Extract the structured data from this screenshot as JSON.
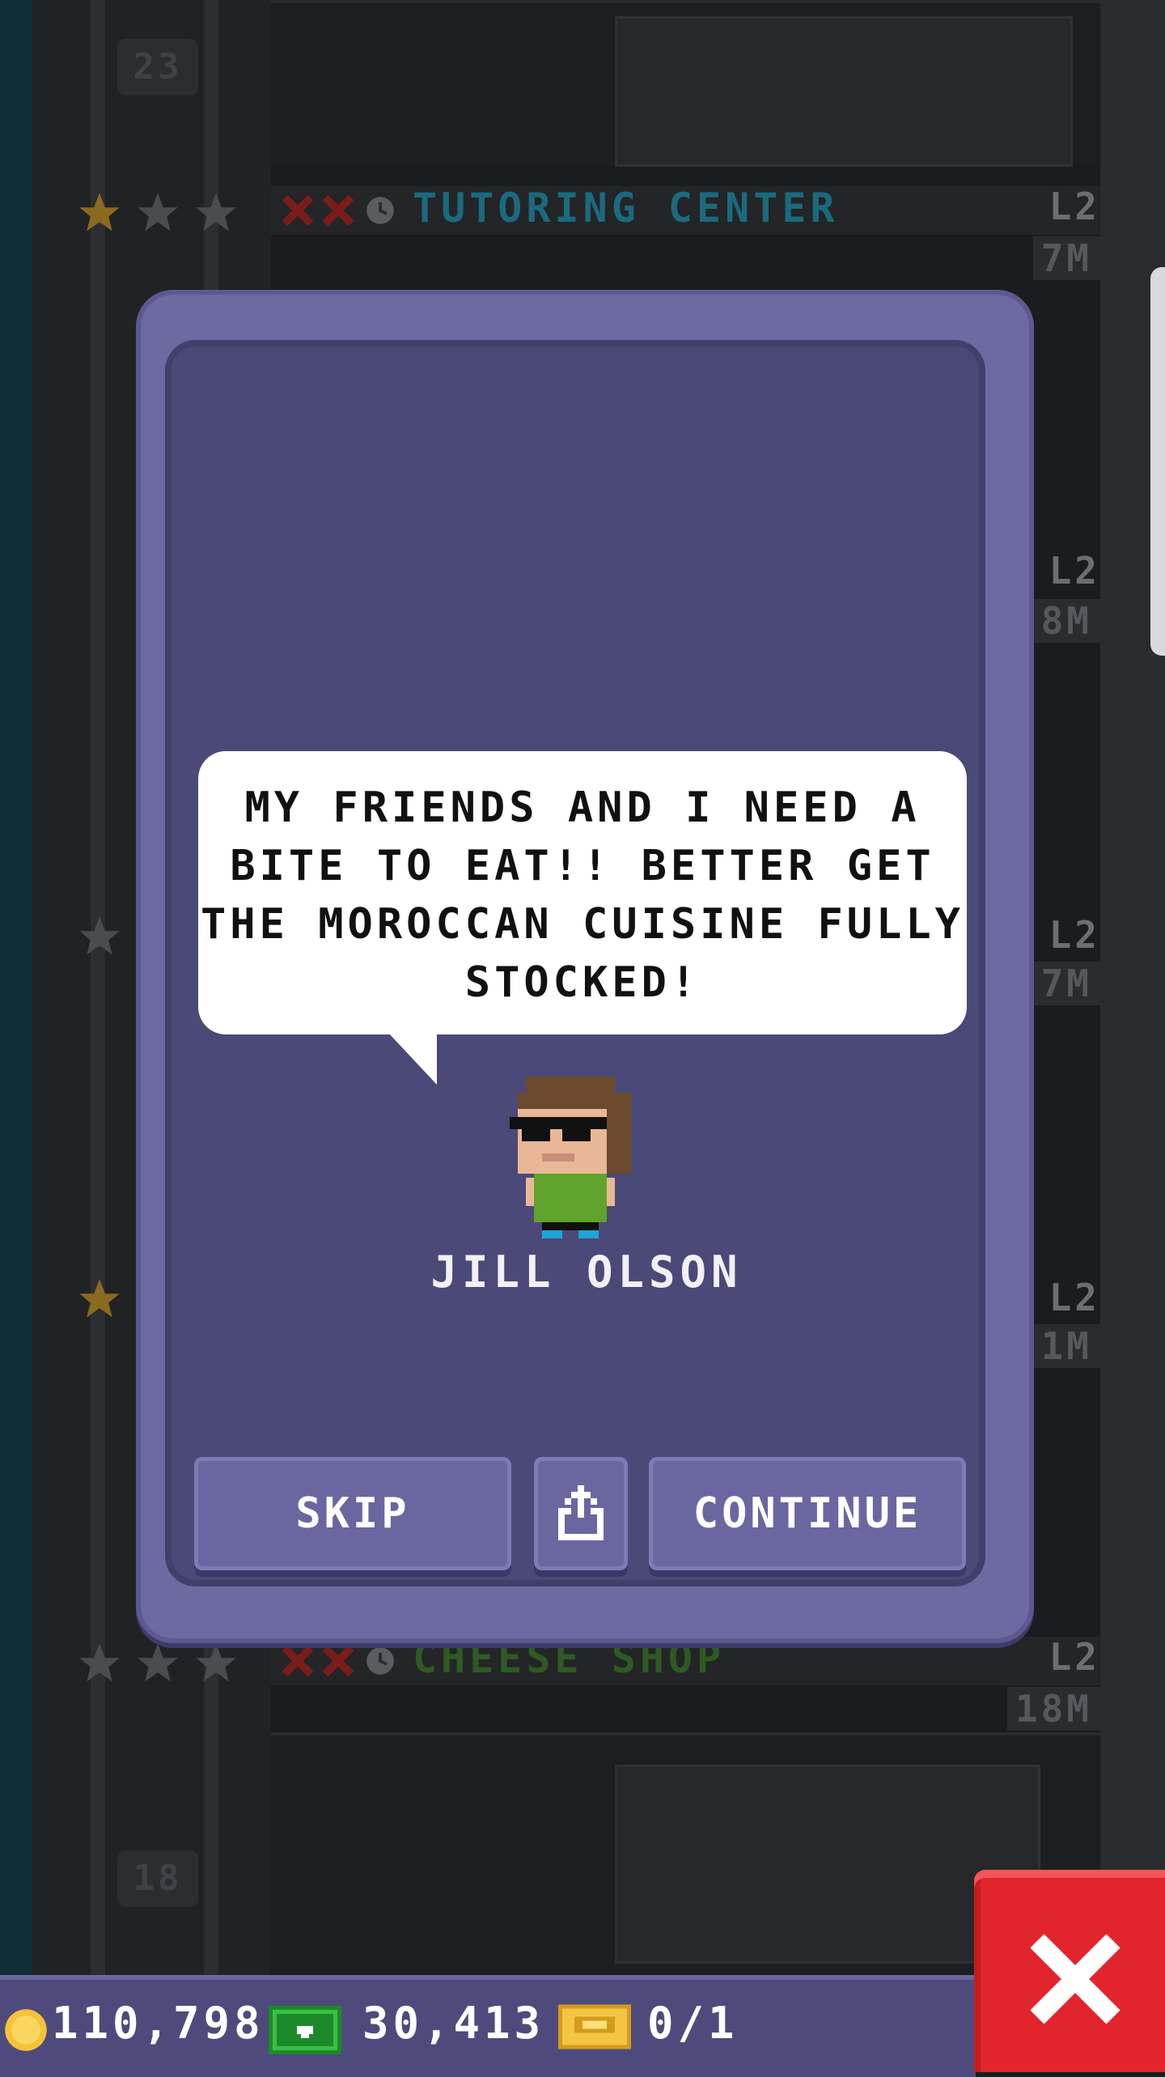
{
  "background": {
    "floors": [
      {
        "number": "23"
      },
      {
        "name": "TUTORING CENTER",
        "level": "L2",
        "time": "7M",
        "name_color": "#1b6a7e"
      },
      {
        "level": "L2",
        "time": "8M"
      },
      {
        "level": "L2",
        "time": "7M"
      },
      {
        "level": "L2",
        "time": "1M"
      },
      {
        "name": "CHEESE SHOP",
        "level": "L2",
        "time": "18M",
        "name_color": "#2f5a23"
      },
      {
        "number": "18"
      }
    ]
  },
  "dialog": {
    "speech": "MY FRIENDS AND I NEED A BITE TO EAT!! BETTER GET THE MOROCCAN CUISINE FULLY STOCKED!",
    "character_name": "JILL OLSON",
    "skip_label": "SKIP",
    "share_icon": "share-icon",
    "continue_label": "CONTINUE"
  },
  "status_bar": {
    "coins": "110,798",
    "bux": "30,413",
    "tickets": "0/1"
  },
  "colors": {
    "dialog": "#6d6aa2",
    "dialog_inner": "#4b4977",
    "close_button": "#e2252c"
  }
}
